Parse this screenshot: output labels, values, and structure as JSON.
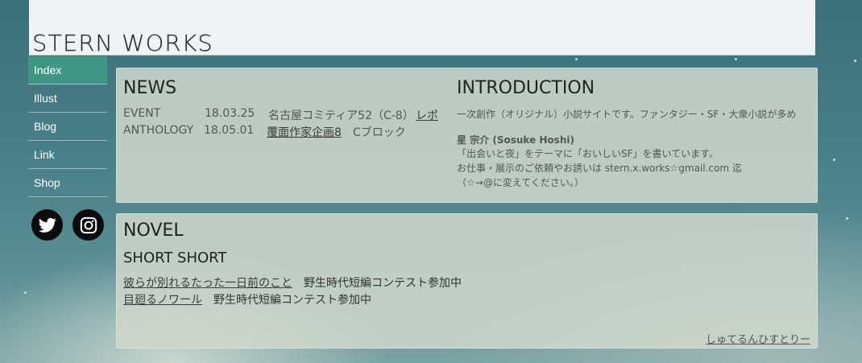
{
  "site": {
    "title": "STERN WORKS"
  },
  "nav": {
    "items": [
      {
        "label": "Index",
        "active": true
      },
      {
        "label": "Illust"
      },
      {
        "label": "Blog"
      },
      {
        "label": "Link"
      },
      {
        "label": "Shop"
      }
    ]
  },
  "social": {
    "twitter_icon": "twitter-icon",
    "instagram_icon": "instagram-icon"
  },
  "news": {
    "title": "NEWS",
    "rows": [
      {
        "category": "EVENT",
        "date": "18.03.25",
        "text": "名古屋コミティア52（C-8）",
        "link": "レポ"
      },
      {
        "category": "ANTHOLOGY",
        "date": "18.05.01",
        "link": "覆面作家企画8",
        "text": "Cブロック"
      }
    ]
  },
  "introduction": {
    "title": "INTRODUCTION",
    "line1": "一次創作（オリジナル）小説サイトです。ファンタジー・SF・大衆小説が多め",
    "name": "星 宗介 (Sosuke Hoshi)",
    "line2": "「出会いと夜」をテーマに「おいしいSF」を書いています。",
    "line3": "お仕事・展示のご依頼やお誘いは stern.x.works☆gmail.com 迄",
    "line4": "（☆→@に変えてください。）"
  },
  "novel": {
    "title": "NOVEL",
    "subtitle": "SHORT SHORT",
    "items": [
      {
        "title": "彼らが別れるたった一日前のこと",
        "note": "野生時代短編コンテスト参加中"
      },
      {
        "title": "目廻るノワール",
        "note": "野生時代短編コンテスト参加中"
      }
    ],
    "more": "しゅてるんひすとりー"
  }
}
